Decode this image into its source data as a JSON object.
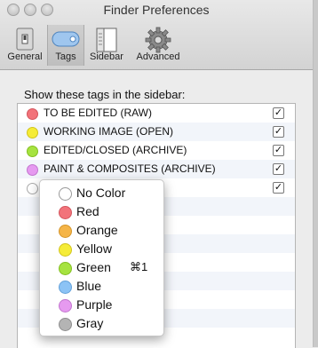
{
  "window": {
    "title": "Finder Preferences"
  },
  "toolbar": {
    "items": [
      {
        "label": "General",
        "icon": "switch-icon",
        "selected": false
      },
      {
        "label": "Tags",
        "icon": "tag-icon",
        "selected": true
      },
      {
        "label": "Sidebar",
        "icon": "sidebar-icon",
        "selected": false
      },
      {
        "label": "Advanced",
        "icon": "gear-icon",
        "selected": false
      }
    ]
  },
  "content": {
    "heading": "Show these tags in the sidebar:",
    "tags": [
      {
        "label": "TO BE EDITED (RAW)",
        "color": "#f2737a",
        "checked": true
      },
      {
        "label": "WORKING IMAGE (OPEN)",
        "color": "#f5ec38",
        "checked": true
      },
      {
        "label": "EDITED/CLOSED (ARCHIVE)",
        "color": "#a6e340",
        "checked": true
      },
      {
        "label": "PAINT & COMPOSITES (ARCHIVE)",
        "color": "#e69af0",
        "checked": true
      },
      {
        "label": "",
        "color": "#ffffff",
        "checked": true
      }
    ],
    "check_mark": "✓"
  },
  "color_menu": {
    "items": [
      {
        "label": "No Color",
        "color": "#ffffff",
        "shortcut": ""
      },
      {
        "label": "Red",
        "color": "#f2737a",
        "shortcut": ""
      },
      {
        "label": "Orange",
        "color": "#f5b548",
        "shortcut": ""
      },
      {
        "label": "Yellow",
        "color": "#f5ec38",
        "shortcut": ""
      },
      {
        "label": "Green",
        "color": "#a6e340",
        "shortcut": "⌘1"
      },
      {
        "label": "Blue",
        "color": "#8cc3f5",
        "shortcut": ""
      },
      {
        "label": "Purple",
        "color": "#e69af0",
        "shortcut": ""
      },
      {
        "label": "Gray",
        "color": "#b4b4b4",
        "shortcut": ""
      }
    ]
  }
}
